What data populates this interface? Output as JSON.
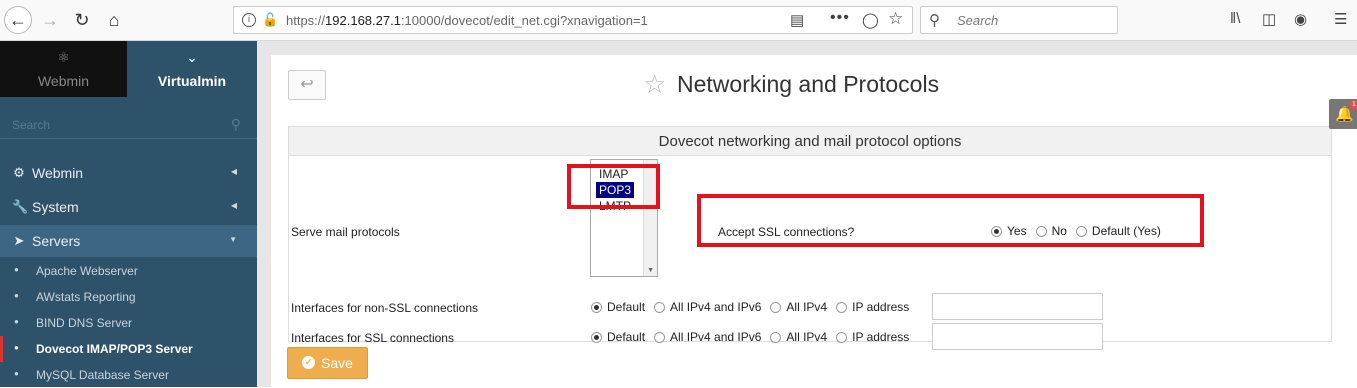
{
  "browser": {
    "url_prefix": "https://",
    "url_host": "192.168.27.1",
    "url_rest": ":10000/dovecot/edit_net.cgi?xnavigation=1",
    "search_placeholder": "Search"
  },
  "sidebar": {
    "tabs": [
      {
        "label": "Webmin",
        "icon": "webmin-logo-icon"
      },
      {
        "label": "Virtualmin",
        "icon": "chevron-down-icon"
      }
    ],
    "search_placeholder": "Search",
    "menu": [
      {
        "label": "Webmin",
        "icon": "gear-icon"
      },
      {
        "label": "System",
        "icon": "wrench-icon"
      },
      {
        "label": "Servers",
        "icon": "rocket-icon"
      }
    ],
    "servers": [
      "Apache Webserver",
      "AWstats Reporting",
      "BIND DNS Server",
      "Dovecot IMAP/POP3 Server",
      "MySQL Database Server"
    ]
  },
  "page": {
    "title": "Networking and Protocols",
    "notification_count": "1"
  },
  "form": {
    "header": "Dovecot networking and mail protocol options",
    "serve_label": "Serve mail protocols",
    "protocols": [
      "IMAP",
      "POP3",
      "LMTP"
    ],
    "selected_protocol": "POP3",
    "ssl_label": "Accept SSL connections?",
    "ssl_options": [
      "Yes",
      "No",
      "Default (Yes)"
    ],
    "ssl_selected": "Yes",
    "nonssl_label": "Interfaces for non-SSL connections",
    "ssl_if_label": "Interfaces for SSL connections",
    "iface_options": [
      "Default",
      "All IPv4 and IPv6",
      "All IPv4",
      "IP address"
    ],
    "iface_selected": "Default",
    "save_label": "Save"
  },
  "colors": {
    "sidebar": "#2f526b",
    "highlight": "#e3121d",
    "save": "#f0ad4e"
  }
}
